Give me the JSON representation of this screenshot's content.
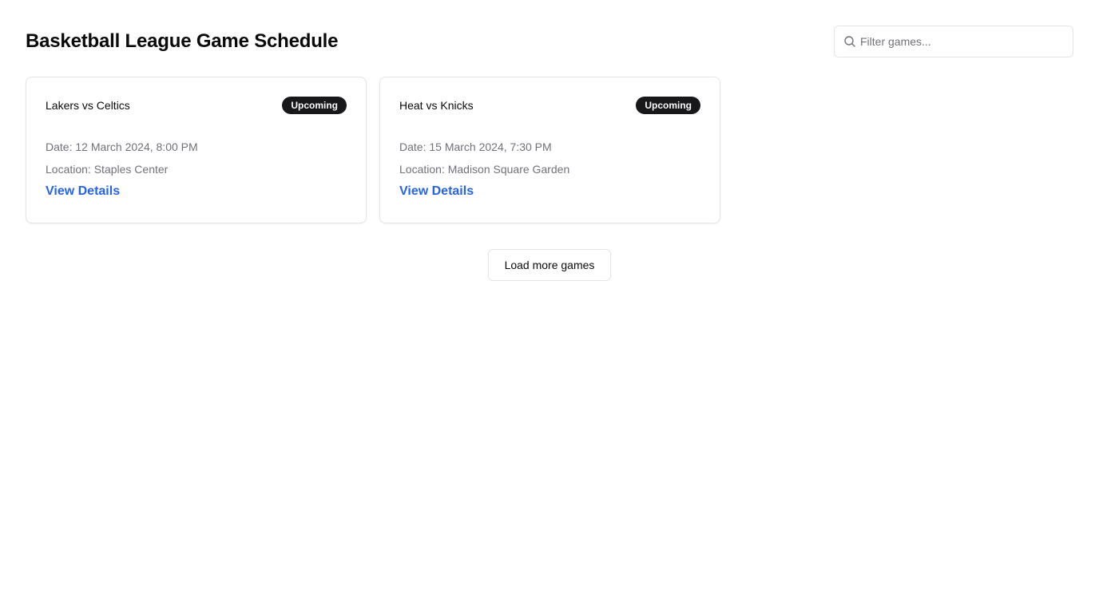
{
  "header": {
    "title": "Basketball League Game Schedule"
  },
  "search": {
    "placeholder": "Filter games...",
    "value": "",
    "icon": "search-icon"
  },
  "games": [
    {
      "title": "Lakers vs Celtics",
      "status": "Upcoming",
      "date": "Date: 12 March 2024, 8:00 PM",
      "location": "Location: Staples Center",
      "link_label": "View Details"
    },
    {
      "title": "Heat vs Knicks",
      "status": "Upcoming",
      "date": "Date: 15 March 2024, 7:30 PM",
      "location": "Location: Madison Square Garden",
      "link_label": "View Details"
    }
  ],
  "load_more_label": "Load more games",
  "colors": {
    "link": "#2563eb",
    "badge_bg": "#18181b",
    "muted_text": "#71717a",
    "border": "#e4e4e7"
  }
}
